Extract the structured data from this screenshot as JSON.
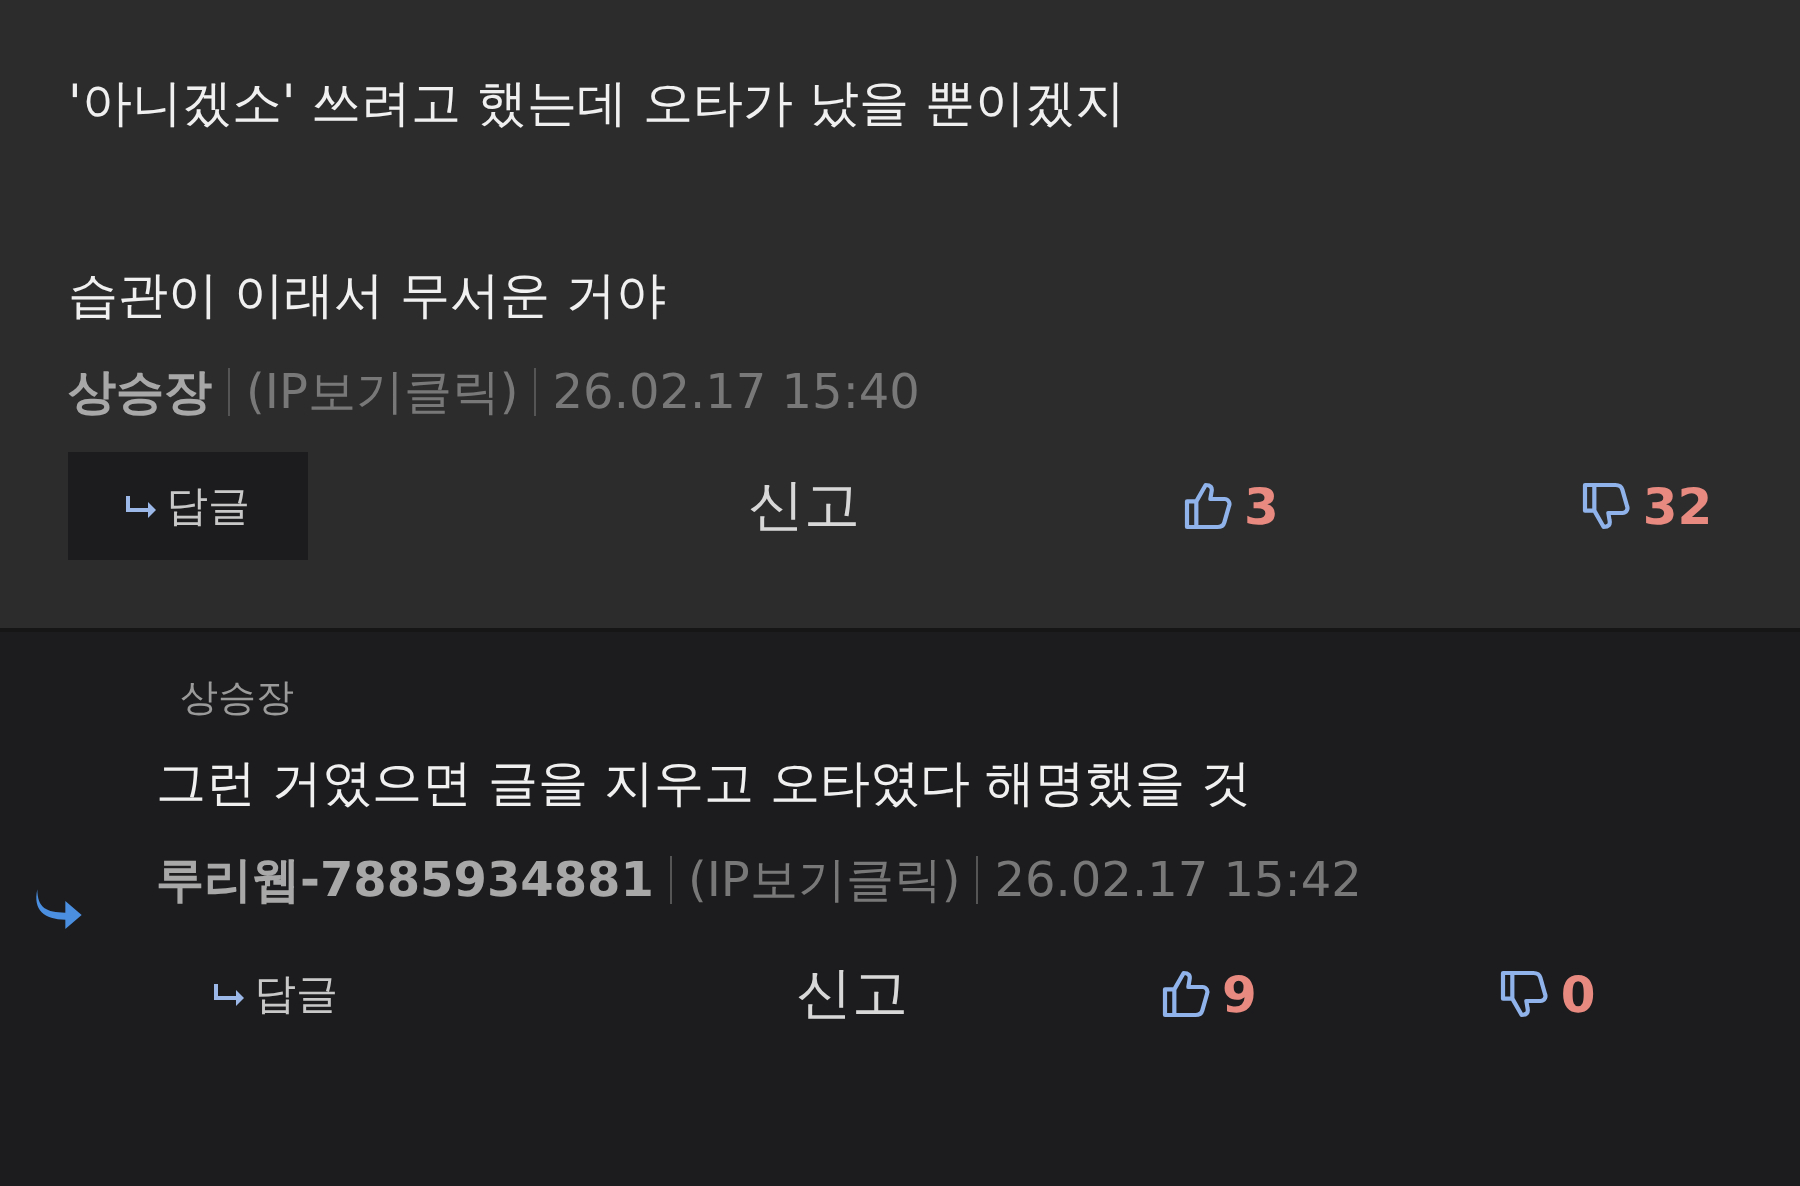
{
  "comments": [
    {
      "kind": "comment",
      "paragraphs": [
        "'아니겠소' 쓰려고 했는데 오타가 났을 뿐이겠지",
        "습관이 이래서 무서운 거야"
      ],
      "author": "상승장",
      "ip": "(IP보기클릭)",
      "date": "26.02.17 15:40",
      "reply": "답글",
      "report": "신고",
      "likes": "3",
      "dislikes": "32"
    },
    {
      "kind": "reply",
      "quoted_author": "상승장",
      "paragraphs": [
        "그런 거였으면 글을 지우고 오타였다 해명했을 것"
      ],
      "author": "루리웹-7885934881",
      "ip": "(IP보기클릭)",
      "date": "26.02.17 15:42",
      "reply": "답글",
      "report": "신고",
      "likes": "9",
      "dislikes": "0"
    }
  ]
}
